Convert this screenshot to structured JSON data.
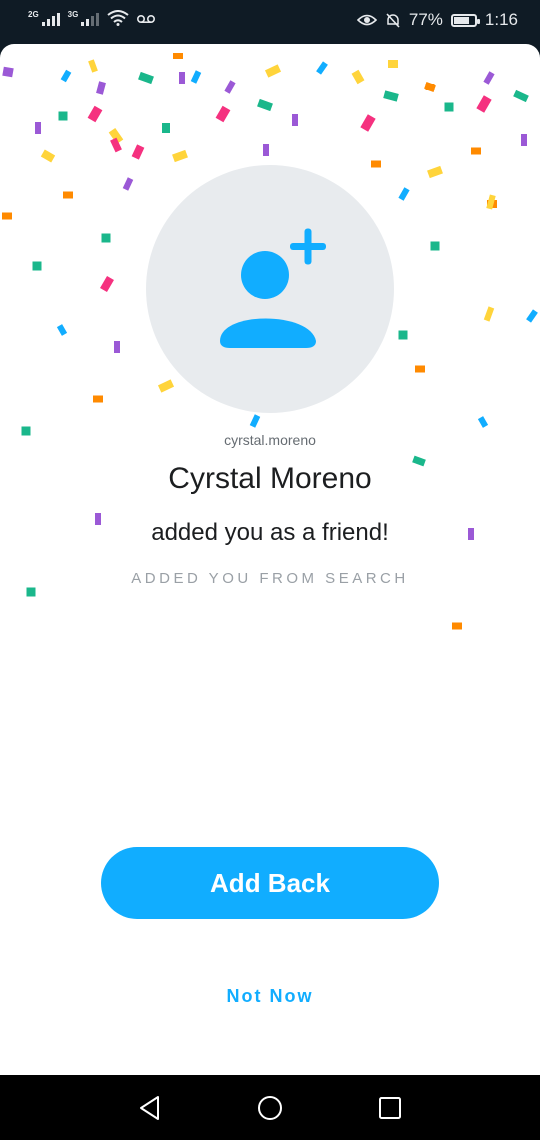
{
  "status_bar": {
    "sim1_label": "2G",
    "sim2_label": "3G",
    "battery_percent_text": "77%",
    "battery_level": 0.77,
    "time": "1:16",
    "icons": [
      "signal-icon",
      "wifi-icon",
      "voicemail-icon",
      "eye-icon",
      "mute-icon",
      "battery-icon"
    ]
  },
  "friend": {
    "username": "cyrstal.moreno",
    "display_name": "Cyrstal Moreno",
    "message": "added you as a friend!",
    "source": "ADDED YOU FROM SEARCH",
    "avatar_icon": "add-friend-icon"
  },
  "actions": {
    "add_back_label": "Add Back",
    "not_now_label": "Not Now"
  },
  "nav": {
    "icons": [
      "back-icon",
      "home-icon",
      "recents-icon"
    ]
  },
  "colors": {
    "accent": "#11adff",
    "confetti": [
      "#11adff",
      "#ffd43b",
      "#9b59d6",
      "#f5317f",
      "#ff8a00",
      "#1ab78b"
    ]
  }
}
